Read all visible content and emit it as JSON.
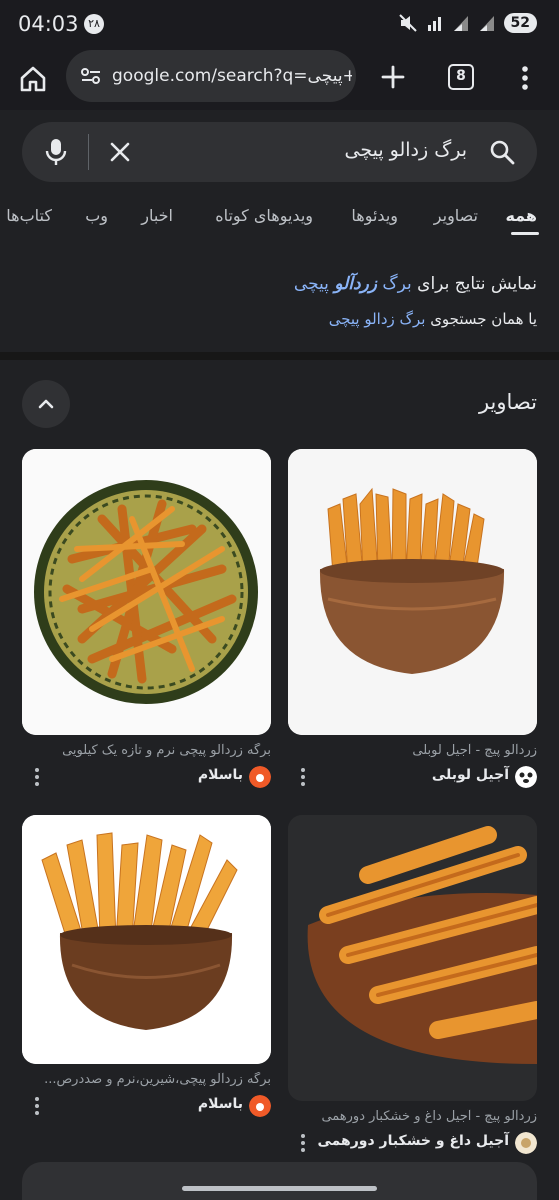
{
  "status_bar": {
    "time": "04:03",
    "date_badge": "۲۸",
    "battery": "52",
    "icons": [
      "mute-icon",
      "wifi-icon",
      "signal-icon",
      "signal-icon"
    ]
  },
  "browser": {
    "url": "google.com/search?q=لو+پیچی",
    "tab_count": "8"
  },
  "search": {
    "query": "برگ زدالو پیچی"
  },
  "tabs": [
    {
      "label": "همه",
      "active": true
    },
    {
      "label": "تصاویر"
    },
    {
      "label": "ویدئوها"
    },
    {
      "label": "ویدیوهای کوتاه"
    },
    {
      "label": "اخبار"
    },
    {
      "label": "وب"
    },
    {
      "label": "کتاب‌ها"
    }
  ],
  "correction": {
    "showing_prefix": "نمایش نتایج برای",
    "corrected_plain": "برگ",
    "corrected_bold": "زردآلو",
    "corrected_tail": "پیچی",
    "instead_prefix": "یا همان جستجوی",
    "original_query": "برگ زدالو پیچی"
  },
  "images_section": {
    "title": "تصاویر",
    "results": [
      {
        "caption": "زردآلو پیچ - آجیل لوبلی",
        "source": "آجیل لوبلی",
        "source_color": "#ffffff"
      },
      {
        "caption": "برگه زردآلو پیچی نرم و تازه یک کیلویی",
        "source": "باسلام",
        "source_color": "#f05a28"
      },
      {
        "caption": "زردآلو پیچ - آجیل داغ و خشکبار دورهمی",
        "source": "آجیل داغ و خشکبار دورهمی",
        "source_color": "#f1e6d0"
      },
      {
        "caption": "برگه زردآلو پیچی،شیرین،نرم و صددرص...",
        "source": "باسلام",
        "source_color": "#f05a28"
      }
    ]
  },
  "colors": {
    "background": "#202124",
    "link": "#8ab4f8",
    "apricot": "#e8952f"
  }
}
